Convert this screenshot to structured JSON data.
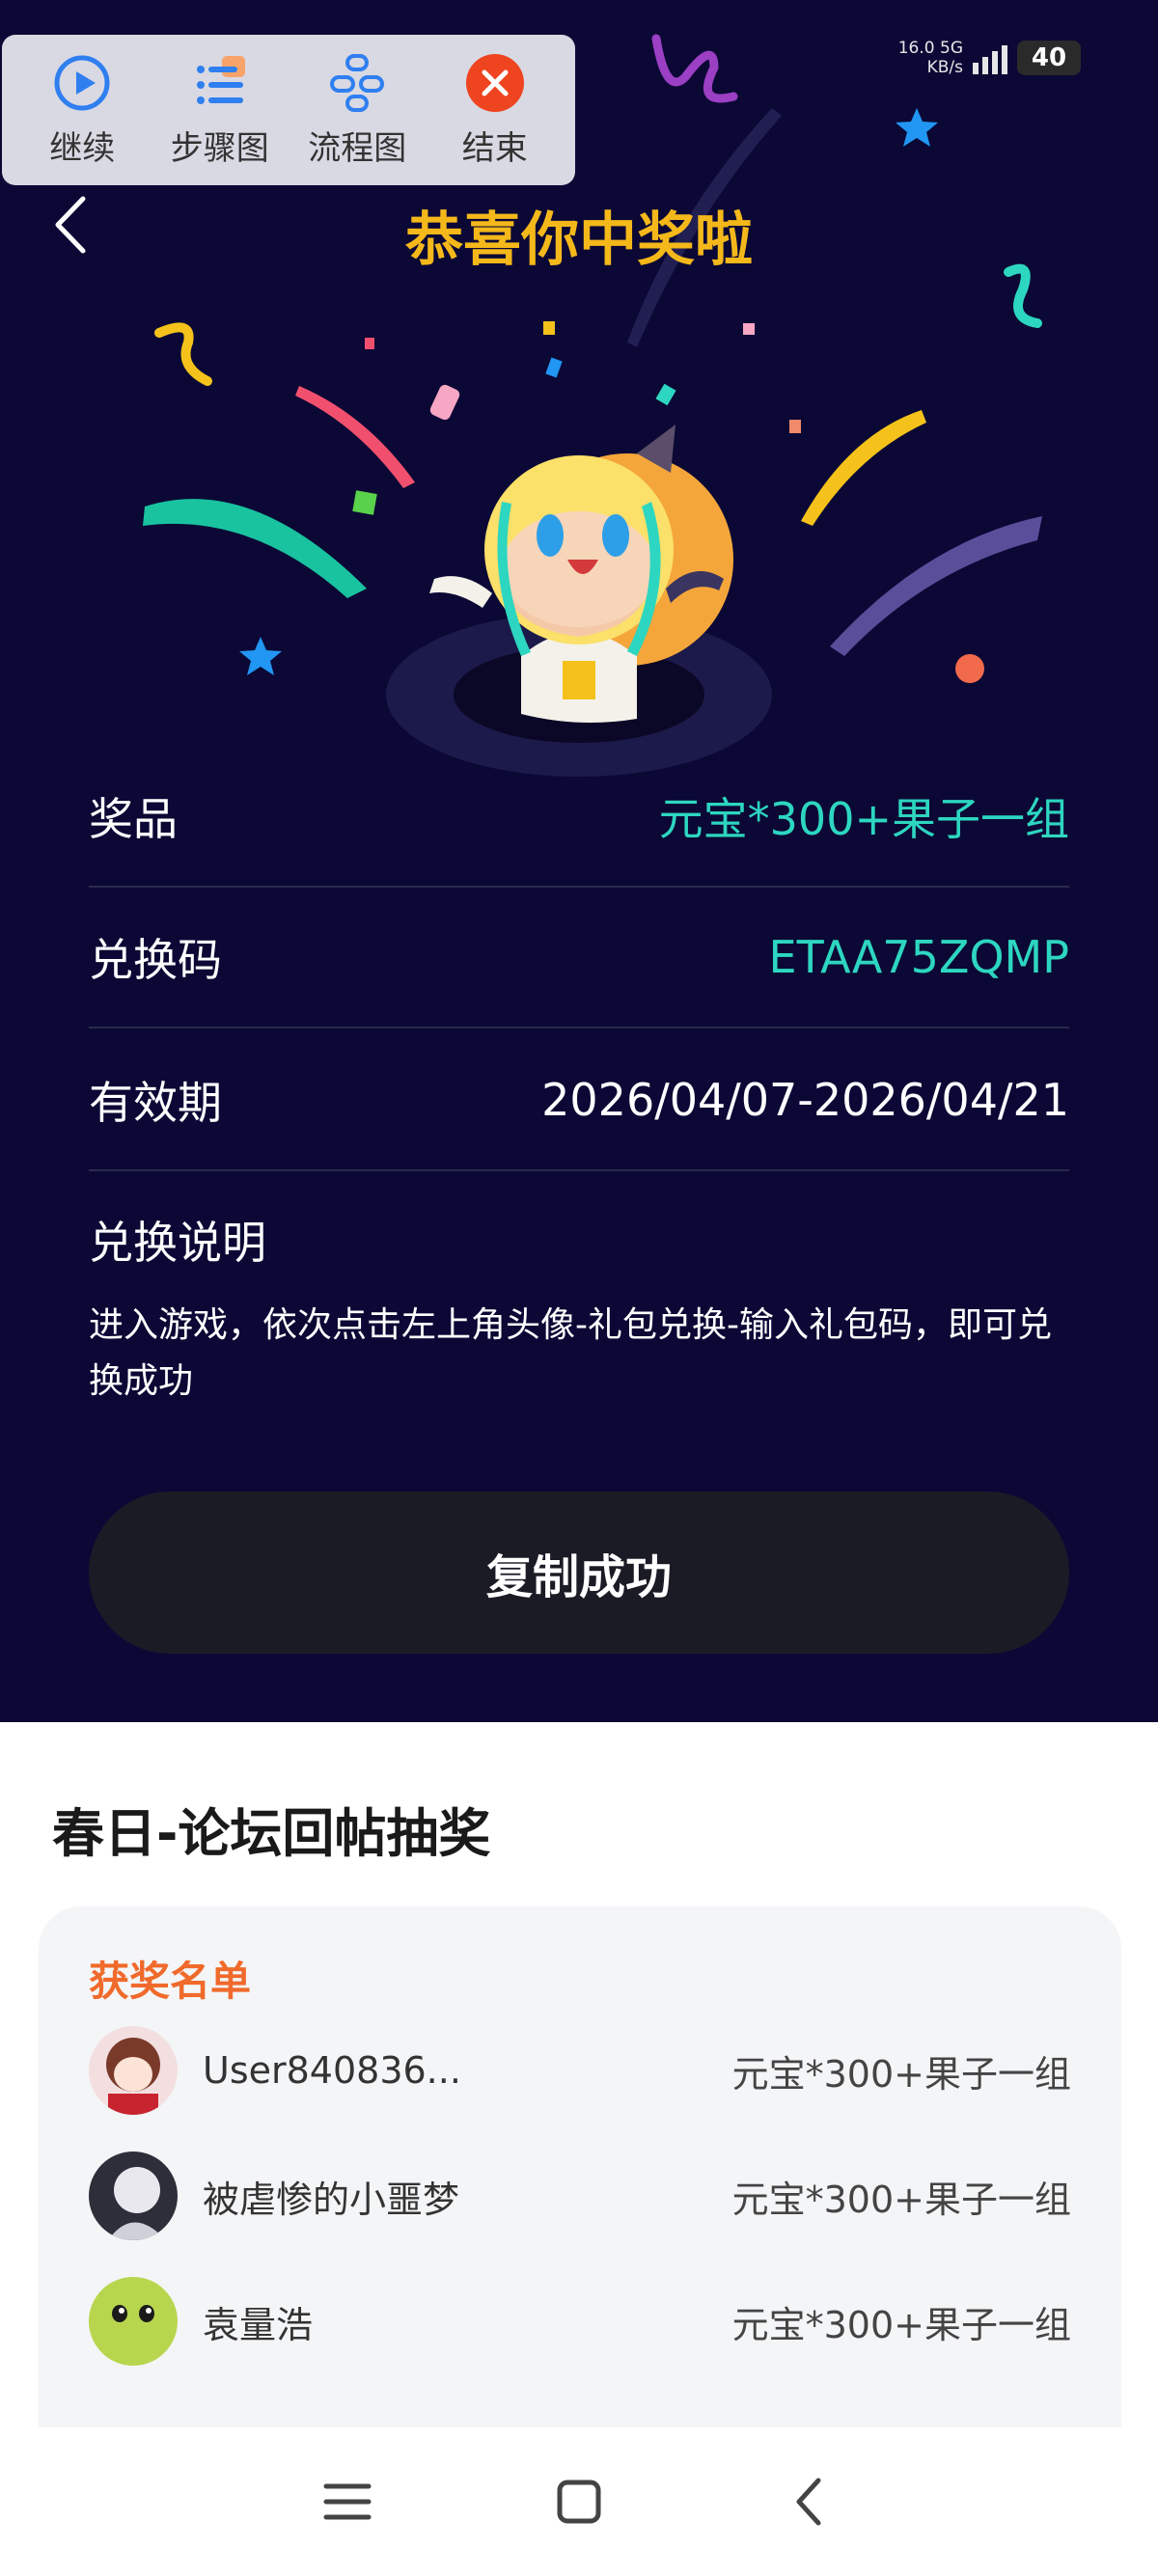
{
  "status": {
    "net_speed": "16.0",
    "net_unit": "KB/s",
    "net_type": "5G",
    "battery": "40"
  },
  "toolbar": {
    "items": [
      {
        "label": "继续"
      },
      {
        "label": "步骤图"
      },
      {
        "label": "流程图"
      },
      {
        "label": "结束"
      }
    ]
  },
  "header": {
    "title": "恭喜你中奖啦"
  },
  "prize": {
    "rows": [
      {
        "label": "奖品",
        "value": "元宝*300+果子一组"
      },
      {
        "label": "兑换码",
        "value": "ETAA75ZQMP"
      },
      {
        "label": "有效期",
        "value": "2026/04/07-2026/04/21"
      }
    ],
    "instructions_title": "兑换说明",
    "instructions_text": "进入游戏，依次点击左上角头像-礼包兑换-输入礼包码，即可兑换成功",
    "copy_button": "复制成功"
  },
  "event": {
    "title": "春日-论坛回帖抽奖",
    "winners_title": "获奖名单",
    "winners": [
      {
        "name": "User840836...",
        "prize": "元宝*300+果子一组"
      },
      {
        "name": "被虐惨的小噩梦",
        "prize": "元宝*300+果子一组"
      },
      {
        "name": "袁量浩",
        "prize": "元宝*300+果子一组"
      }
    ]
  },
  "colors": {
    "background": "#0b0835",
    "title": "#f4b81a",
    "accent_teal": "#2dd6c0",
    "winners_title": "#f06a2b"
  }
}
